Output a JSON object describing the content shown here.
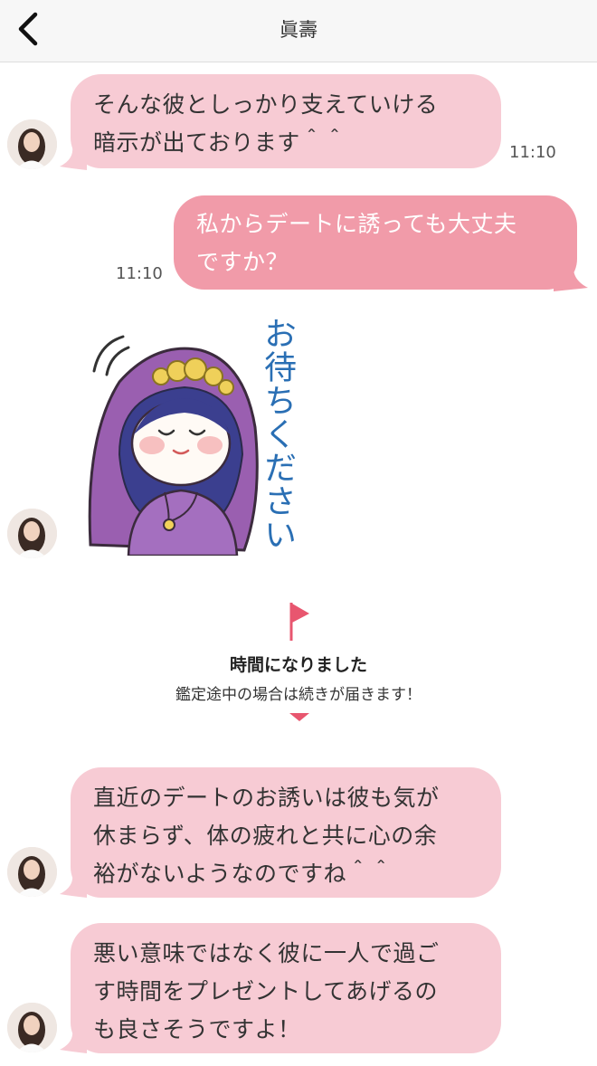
{
  "header": {
    "title": "眞壽"
  },
  "messages": [
    {
      "text": "そんな彼としっかり支えていける\n暗示が出ております＾＾",
      "time": "11:10"
    },
    {
      "text": "私からデートに誘っても大丈夫\nですか？",
      "time": "11:10"
    },
    {
      "sticker_text": "お待ちください"
    },
    {
      "text": "直近のデートのお誘いは彼も気が\n休まらず、体の疲れと共に心の余\n裕がないようなのですね＾＾"
    },
    {
      "text": "悪い意味ではなく彼に一人で過ご\nす時間をプレゼントしてあげるの\nも良さそうですよ！"
    }
  ],
  "notice": {
    "title": "時間になりました",
    "subtitle": "鑑定途中の場合は続きが届きます！"
  },
  "colors": {
    "incoming_bubble": "#f7cbd4",
    "outgoing_bubble": "#f19ba9",
    "notice_accent": "#e8566f",
    "sticker_text": "#2a6fb4"
  },
  "icons": {
    "back": "chevron-left-icon",
    "flag": "flag-icon",
    "marker": "triangle-down-icon"
  }
}
